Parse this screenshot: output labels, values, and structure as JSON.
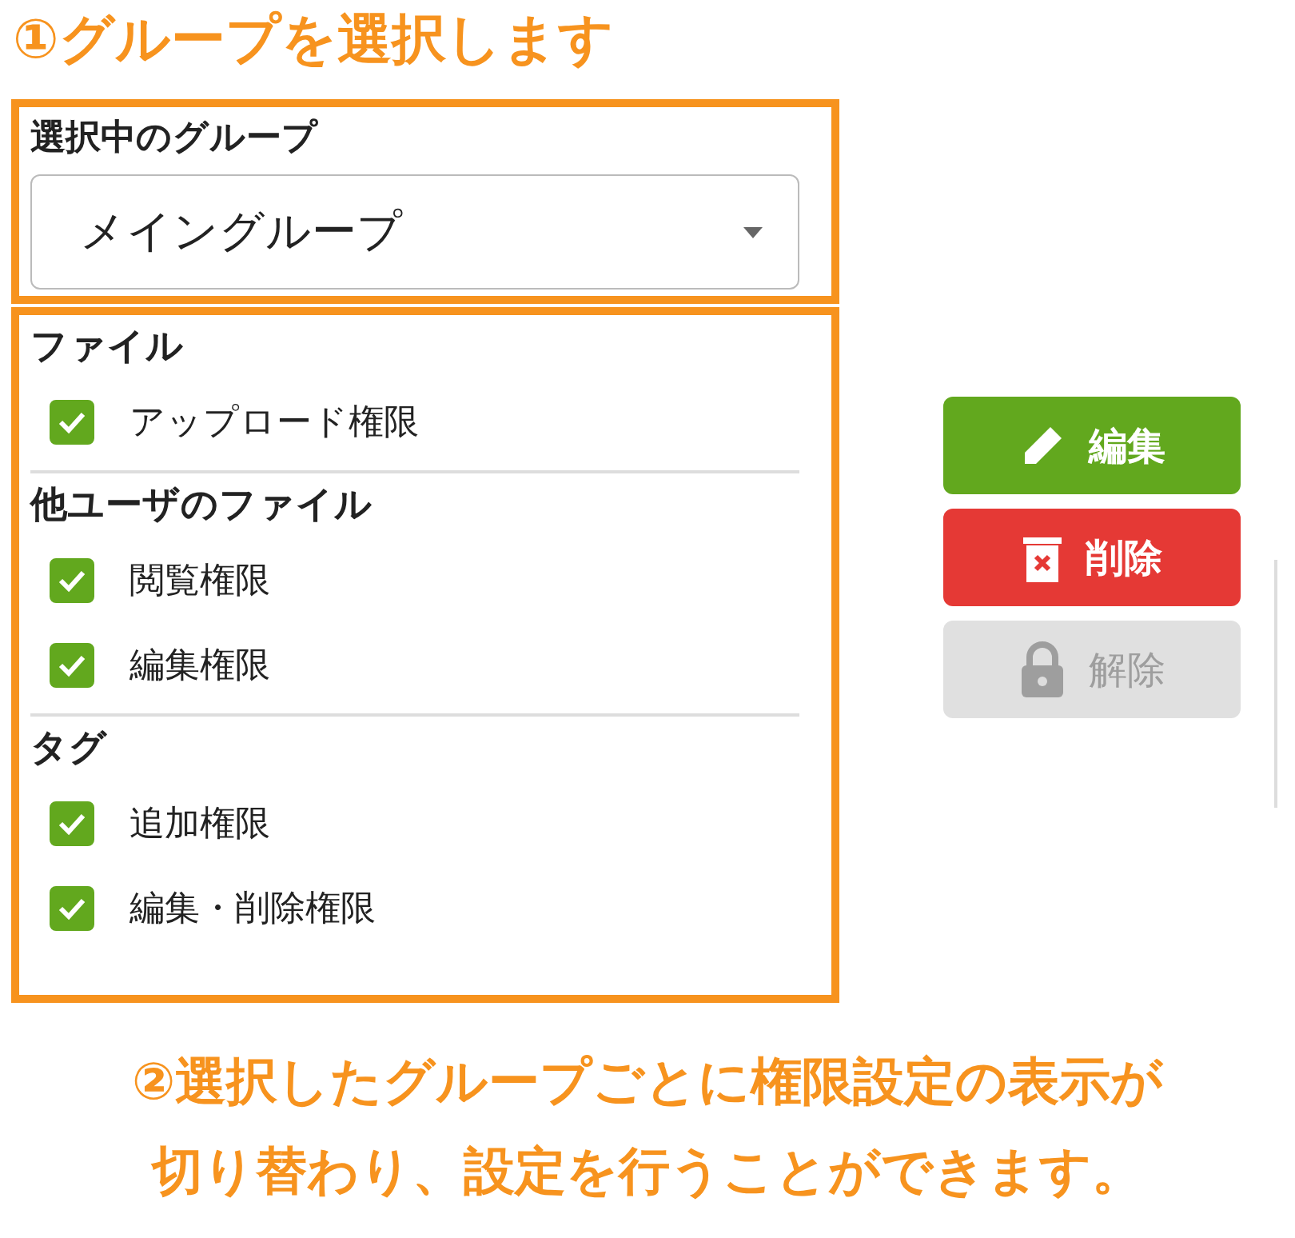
{
  "step1_caption": "①グループを選択します",
  "group_select": {
    "label": "選択中のグループ",
    "value": "メイングループ"
  },
  "permission_groups": [
    {
      "heading": "ファイル",
      "items": [
        {
          "label": "アップロード権限",
          "checked": true
        }
      ]
    },
    {
      "heading": "他ユーザのファイル",
      "items": [
        {
          "label": "閲覧権限",
          "checked": true
        },
        {
          "label": "編集権限",
          "checked": true
        }
      ]
    },
    {
      "heading": "タグ",
      "items": [
        {
          "label": "追加権限",
          "checked": true
        },
        {
          "label": "編集・削除権限",
          "checked": true
        }
      ]
    }
  ],
  "buttons": [
    {
      "kind": "edit",
      "label": "編集",
      "disabled": false
    },
    {
      "kind": "delete",
      "label": "削除",
      "disabled": false
    },
    {
      "kind": "unlock",
      "label": "解除",
      "disabled": true
    }
  ],
  "step2_caption": [
    "②選択したグループごとに権限設定の表示が",
    "切り替わり、設定を行うことができます。"
  ]
}
